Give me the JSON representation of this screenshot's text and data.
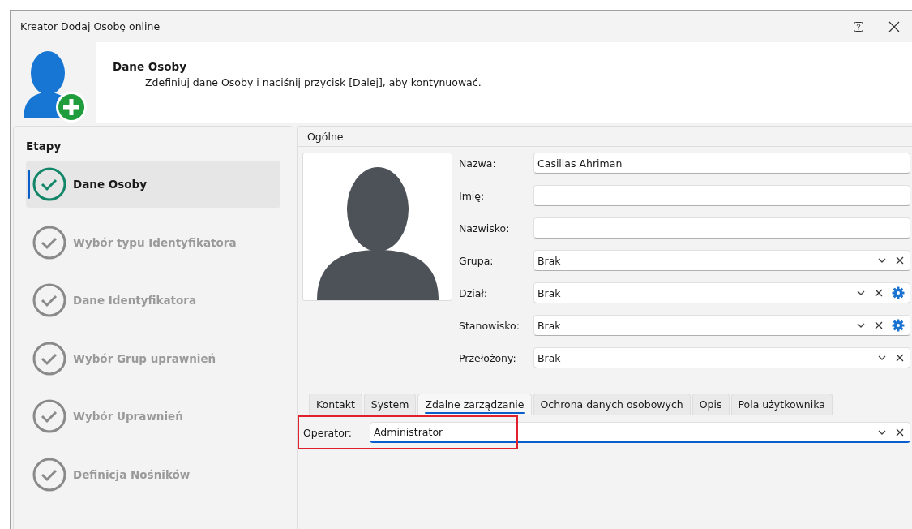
{
  "window": {
    "title": "Kreator Dodaj Osobę online"
  },
  "header": {
    "title": "Dane Osoby",
    "subtitle": "Zdefiniuj dane Osoby i naciśnij przycisk [Dalej], aby kontynuować."
  },
  "steps_title": "Etapy",
  "steps": [
    {
      "label": "Dane Osoby",
      "selected": true
    },
    {
      "label": "Wybór typu Identyfikatora",
      "selected": false
    },
    {
      "label": "Dane Identyfikatora",
      "selected": false
    },
    {
      "label": "Wybór Grup uprawnień",
      "selected": false
    },
    {
      "label": "Wybór Uprawnień",
      "selected": false
    },
    {
      "label": "Definicja Nośników",
      "selected": false
    }
  ],
  "group_title": "Ogólne",
  "fields": [
    {
      "label": "Nazwa:",
      "kind": "text",
      "value": "Casillas Ahriman"
    },
    {
      "label": "Imię:",
      "kind": "text"
    },
    {
      "label": "Nazwisko:",
      "kind": "text"
    },
    {
      "label": "Grupa:",
      "kind": "combo",
      "value": "Brak",
      "settings_button": false
    },
    {
      "label": "Dział:",
      "kind": "combo",
      "value": "Brak",
      "settings_button": true
    },
    {
      "label": "Stanowisko:",
      "kind": "combo",
      "value": "Brak",
      "settings_button": true
    },
    {
      "label": "Przełożony:",
      "kind": "combo",
      "value": "Brak",
      "settings_button": false
    }
  ],
  "tabs": [
    {
      "label": "Kontakt",
      "selected": false
    },
    {
      "label": "System",
      "selected": false
    },
    {
      "label": "Zdalne zarządzanie",
      "selected": true
    },
    {
      "label": "Ochrona danych osobowych",
      "selected": false
    },
    {
      "label": "Opis",
      "selected": false
    },
    {
      "label": "Pola użytkownika",
      "selected": false
    }
  ],
  "operator": {
    "label": "Operator:",
    "value": "Administrator"
  }
}
